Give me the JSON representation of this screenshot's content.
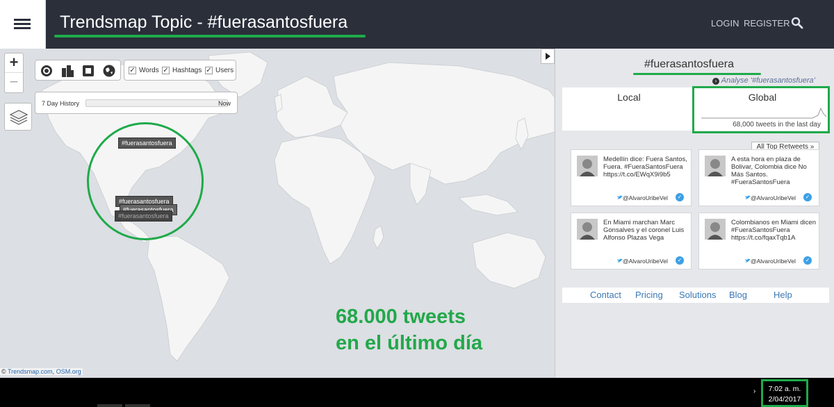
{
  "header": {
    "title": "Trendsmap Topic - #fuerasantosfuera",
    "login": "LOGIN",
    "register": "REGISTER",
    "underline_color": "#1faa4a",
    "background": "#2a2f3a"
  },
  "map": {
    "filters": {
      "words": "Words",
      "hashtags": "Hashtags",
      "users": "Users",
      "words_checked": true,
      "hashtags_checked": true,
      "users_checked": true
    },
    "history": {
      "label": "7 Day History",
      "now": "Now"
    },
    "zoom_in": "+",
    "zoom_out": "−",
    "tags": [
      "#fuerasantosfuera",
      "#fuerasantosfuera",
      "#fuerasantosfuera",
      "#fuerasantosfuera"
    ],
    "annotation_line1": "68.000 tweets",
    "annotation_line2": "en el último día",
    "attribution_prefix": "© ",
    "attribution_link1": "Trendsmap.com",
    "attribution_sep": ", ",
    "attribution_link2": "OSM.org"
  },
  "sidebar": {
    "topic": "#fuerasantosfuera",
    "analyse": "Analyse '#fuerasantosfuera'",
    "local_tab": "Local",
    "global_tab": "Global",
    "global_stat": "68,000 tweets in the last day",
    "all_top_retweets": "All Top Retweets »",
    "tweets": [
      {
        "text": "Medellín dice: Fuera Santos, Fuera. #FueraSantosFuera https://t.co/EWqX9i9b5",
        "user": "@AlvaroUribeVel"
      },
      {
        "text": "A esta hora en plaza de Bolivar, Colombia dice No Más Santos. #FueraSantosFuera",
        "user": "@AlvaroUribeVel"
      },
      {
        "text": "En Miami marchan Marc Gonsalves y el coronel Luis Alfonso Plazas Vega",
        "user": "@AlvaroUribeVel"
      },
      {
        "text": "Colombianos en Miami dicen #FueraSantosFuera https://t.co/fqaxTqb1A",
        "user": "@AlvaroUribeVel"
      }
    ],
    "footer_links": [
      "Contact",
      "Pricing",
      "Solutions",
      "Blog",
      "Help"
    ]
  },
  "taskbar": {
    "time": "7:02 a. m.",
    "date": "2/04/2017",
    "chevron": "›"
  }
}
